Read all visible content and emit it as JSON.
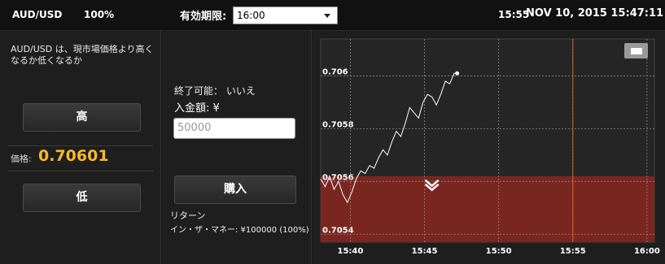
{
  "header": {
    "pair": "AUD/USD",
    "percent": "100%",
    "expiry_label": "有効期限:",
    "expiry_value": "16:00",
    "time": "15:55",
    "datetime": "NOV 10, 2015 15:47:11"
  },
  "left": {
    "description": "AUD/USD は、現市場価格より高くなるか低くなるか",
    "high_label": "高",
    "price_label": "価格:",
    "price_value": "0.70601",
    "low_label": "低"
  },
  "middle": {
    "available": "終了可能： いいえ",
    "amount_label": "入金額: ¥",
    "amount_placeholder": "50000",
    "buy_label": "購入",
    "return_label": "リターン",
    "itm_label": "イン・ザ・マネー: ¥100000 (100%)"
  },
  "chart_data": {
    "type": "line",
    "x_ticks": [
      "15:40",
      "15:45",
      "15:50",
      "15:55",
      "16:00"
    ],
    "y_ticks": [
      "0.706",
      "0.7058",
      "0.7056",
      "0.7054"
    ],
    "ylim": [
      0.70537,
      0.70614
    ],
    "xlim_minutes": [
      38.0,
      60.5
    ],
    "current_time_minute": 55.0,
    "strike_zone_top": 0.70562,
    "colors": {
      "background": "#1e1e1e",
      "zone": "#7a2620",
      "line": "#ffffff",
      "grid": "#8a8a8a",
      "time_line": "#e0641c",
      "marker": "#ffffff"
    },
    "series": [
      {
        "x": [
          38.0,
          38.3,
          38.6,
          38.9,
          39.2,
          39.5,
          39.8,
          40.1,
          40.4,
          40.7,
          41.0,
          41.3,
          41.6,
          41.9,
          42.2,
          42.5,
          42.8,
          43.1,
          43.4,
          43.7,
          44.0,
          44.3,
          44.6,
          44.9,
          45.2,
          45.5,
          45.8,
          46.1,
          46.4,
          46.7,
          47.0,
          47.2
        ],
        "y": [
          0.70561,
          0.70558,
          0.70562,
          0.70557,
          0.7056,
          0.70555,
          0.70552,
          0.70556,
          0.70561,
          0.70564,
          0.70563,
          0.70566,
          0.70565,
          0.70569,
          0.70572,
          0.7057,
          0.70575,
          0.70579,
          0.70577,
          0.70582,
          0.70588,
          0.70586,
          0.70584,
          0.7059,
          0.70593,
          0.70592,
          0.70589,
          0.70593,
          0.70598,
          0.70597,
          0.70601,
          0.70601
        ]
      }
    ]
  },
  "chart_icons": {
    "toggle_icon": "window-toggle-icon",
    "marker_icon": "chevron-down-marker-icon"
  }
}
